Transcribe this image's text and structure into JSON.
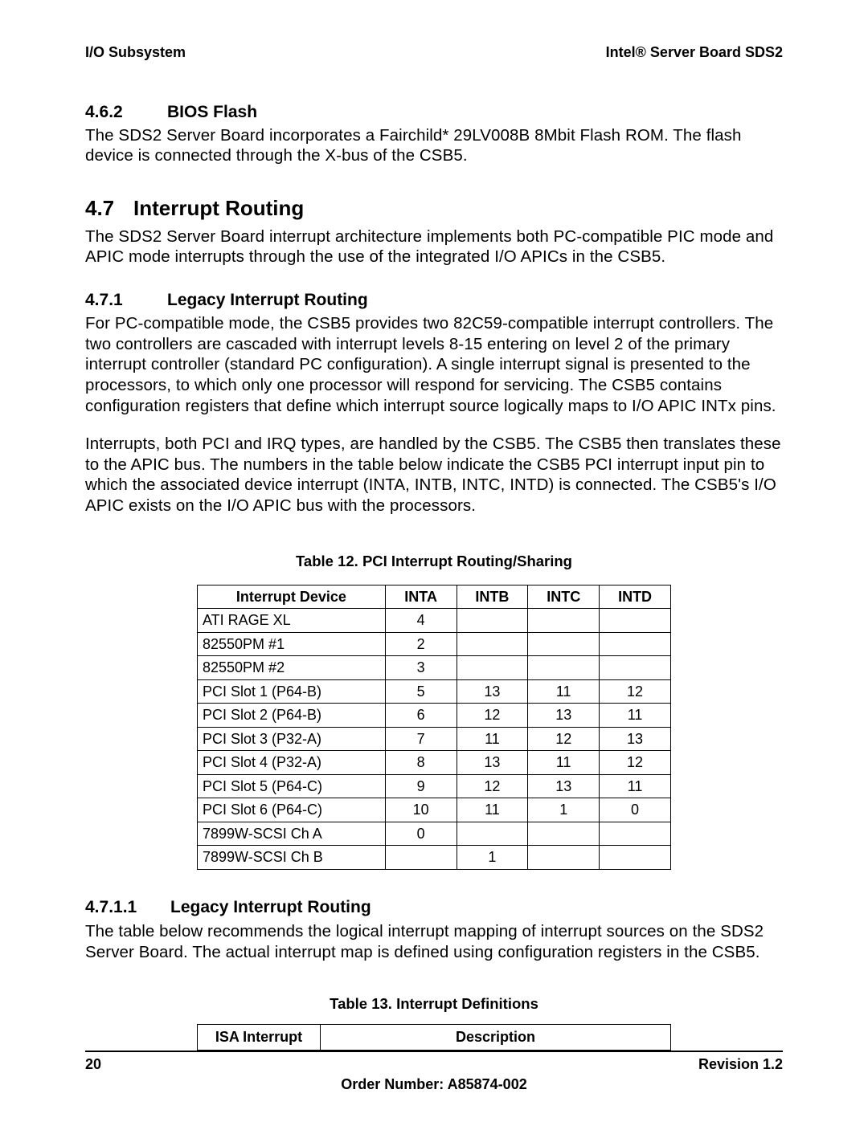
{
  "header": {
    "left": "I/O Subsystem",
    "right": "Intel® Server Board SDS2"
  },
  "section_4_6_2": {
    "num": "4.6.2",
    "title": "BIOS Flash",
    "body": "The SDS2 Server Board incorporates a Fairchild* 29LV008B 8Mbit Flash ROM. The flash device is connected through the X-bus of the CSB5."
  },
  "section_4_7": {
    "num": "4.7",
    "title": "Interrupt Routing",
    "body": "The SDS2 Server Board interrupt architecture implements both PC-compatible PIC mode and APIC mode interrupts through the use of the integrated I/O APICs in the CSB5."
  },
  "section_4_7_1": {
    "num": "4.7.1",
    "title": "Legacy Interrupt Routing",
    "p1": "For PC-compatible mode, the CSB5 provides two 82C59-compatible interrupt controllers. The two controllers are cascaded with interrupt levels 8-15 entering on level 2 of the primary interrupt controller (standard PC configuration). A single interrupt signal is presented to the processors, to which only one processor will respond for servicing. The CSB5 contains configuration registers that define which interrupt source logically maps to I/O APIC INTx pins.",
    "p2": "Interrupts, both PCI and IRQ types, are handled by the CSB5. The CSB5 then translates these to the APIC bus. The numbers in the table below indicate the CSB5 PCI interrupt input pin to which the associated device interrupt (INTA, INTB, INTC, INTD) is connected.  The CSB5's I/O APIC exists on the I/O APIC bus with the processors."
  },
  "table12": {
    "caption": "Table 12. PCI Interrupt Routing/Sharing",
    "headers": [
      "Interrupt Device",
      "INTA",
      "INTB",
      "INTC",
      "INTD"
    ],
    "rows": [
      {
        "device": "ATI RAGE XL",
        "a": "4",
        "b": "",
        "c": "",
        "d": ""
      },
      {
        "device": "82550PM #1",
        "a": "2",
        "b": "",
        "c": "",
        "d": ""
      },
      {
        "device": "82550PM #2",
        "a": "3",
        "b": "",
        "c": "",
        "d": ""
      },
      {
        "device": "PCI Slot 1 (P64-B)",
        "a": "5",
        "b": "13",
        "c": "11",
        "d": "12"
      },
      {
        "device": "PCI Slot 2 (P64-B)",
        "a": "6",
        "b": "12",
        "c": "13",
        "d": "11"
      },
      {
        "device": "PCI Slot 3 (P32-A)",
        "a": "7",
        "b": "11",
        "c": "12",
        "d": "13"
      },
      {
        "device": "PCI Slot 4 (P32-A)",
        "a": "8",
        "b": "13",
        "c": "11",
        "d": "12"
      },
      {
        "device": "PCI Slot 5 (P64-C)",
        "a": "9",
        "b": "12",
        "c": "13",
        "d": "11"
      },
      {
        "device": "PCI Slot 6 (P64-C)",
        "a": "10",
        "b": "11",
        "c": "1",
        "d": "0"
      },
      {
        "device": "7899W-SCSI Ch A",
        "a": "0",
        "b": "",
        "c": "",
        "d": ""
      },
      {
        "device": "7899W-SCSI Ch B",
        "a": "",
        "b": "1",
        "c": "",
        "d": ""
      }
    ]
  },
  "section_4_7_1_1": {
    "num": "4.7.1.1",
    "title": "Legacy Interrupt Routing",
    "body": "The table below recommends the logical interrupt mapping of interrupt sources on the SDS2 Server Board. The actual interrupt map is defined using configuration registers in the CSB5."
  },
  "table13": {
    "caption": "Table 13. Interrupt Definitions",
    "headers": [
      "ISA Interrupt",
      "Description"
    ]
  },
  "footer": {
    "page": "20",
    "revision": "Revision 1.2",
    "order": "Order Number:  A85874-002"
  }
}
